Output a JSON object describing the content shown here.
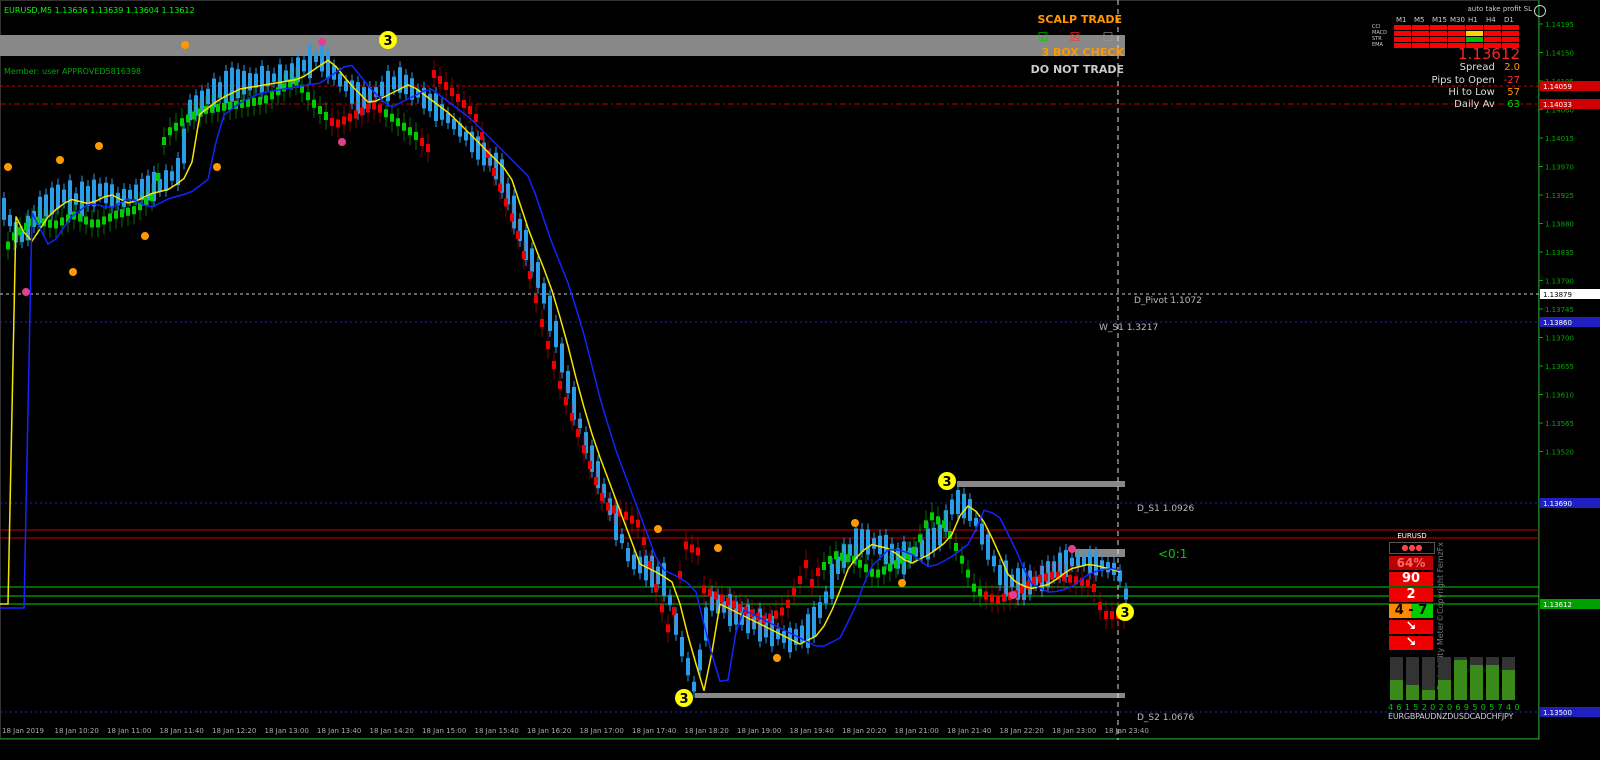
{
  "window": {
    "symbol_line": "EURUSD,M5  1.13636 1.13639 1.13604 1.13612",
    "member_text": "Member: user   APPROVED5816398",
    "auto_tp": "auto take profit SL"
  },
  "alerts": {
    "scalp_trade": "SCALP TRADE",
    "box_check": "3 BOX CHECK",
    "do_not_trade": "DO NOT TRADE",
    "check_marks": [
      "☑",
      "☒",
      "☐"
    ]
  },
  "mtf": {
    "timeframes": [
      "M1",
      "M5",
      "M15",
      "M30",
      "H1",
      "H4",
      "D1"
    ],
    "rows": [
      "CCI",
      "MACD",
      "STR",
      "EMA"
    ],
    "colors": {
      "red": "#ff0000",
      "yellow": "#ffd200",
      "green": "#00c000"
    }
  },
  "stats": {
    "price": "1.13612",
    "spread_label": "Spread",
    "spread": "2.0",
    "pips_label": "Pips to Open",
    "pips": "-27",
    "hilo_label": "Hi to Low",
    "hilo": "57",
    "daily_label": "Daily Av",
    "daily": "63"
  },
  "levels": {
    "d_pivot": "D_Pivot 1.1072",
    "w_s1": "W_S1 1.3217",
    "d_s1": "D_S1 1.0926",
    "d_s2": "D_S2 1.0676",
    "ratio": "<0:1"
  },
  "price_axis": {
    "ticks": [
      "1.14195",
      "1.14150",
      "1.14105",
      "1.14060",
      "1.14015",
      "1.13970",
      "1.13925",
      "1.13880",
      "1.13835",
      "1.13790",
      "1.13745",
      "1.13700",
      "1.13655",
      "1.13610",
      "1.13565",
      "1.13520"
    ],
    "tags": [
      {
        "text": "1.14059",
        "color": "#d00000"
      },
      {
        "text": "1.14033",
        "color": "#d00000"
      },
      {
        "text": "1.13879",
        "color": "#ffffff"
      },
      {
        "text": "1.13860",
        "color": "#2020c0"
      },
      {
        "text": "1.13690",
        "color": "#2020c0"
      },
      {
        "text": "1.13612",
        "color": "#00a000"
      },
      {
        "text": "1.13500",
        "color": "#2020c0"
      }
    ]
  },
  "time_axis": [
    "18 Jan 2019",
    "18 Jan 10:20",
    "18 Jan 11:00",
    "18 Jan 11:40",
    "18 Jan 12:20",
    "18 Jan 13:00",
    "18 Jan 13:40",
    "18 Jan 14:20",
    "18 Jan 15:00",
    "18 Jan 15:40",
    "18 Jan 16:20",
    "18 Jan 17:00",
    "18 Jan 17:40",
    "18 Jan 18:20",
    "18 Jan 19:00",
    "18 Jan 19:40",
    "18 Jan 20:20",
    "18 Jan 21:00",
    "18 Jan 21:40",
    "18 Jan 22:20",
    "18 Jan 23:00",
    "18 Jan 23:40"
  ],
  "markers": {
    "three": "3"
  },
  "prob_meter": {
    "pair": "EURUSD",
    "percent": "64%",
    "v1": "90",
    "v2": "2",
    "v3": "4 - 7",
    "arrow": "↘",
    "side_text": "Probability Meter©Copyright FemzFx",
    "strength_values": "4 6 1 5 2 0 2 0 6 9 5 0 5 7 4 0",
    "currencies": "EURGBPAUDNZDUSDCADCHFJPY"
  }
}
